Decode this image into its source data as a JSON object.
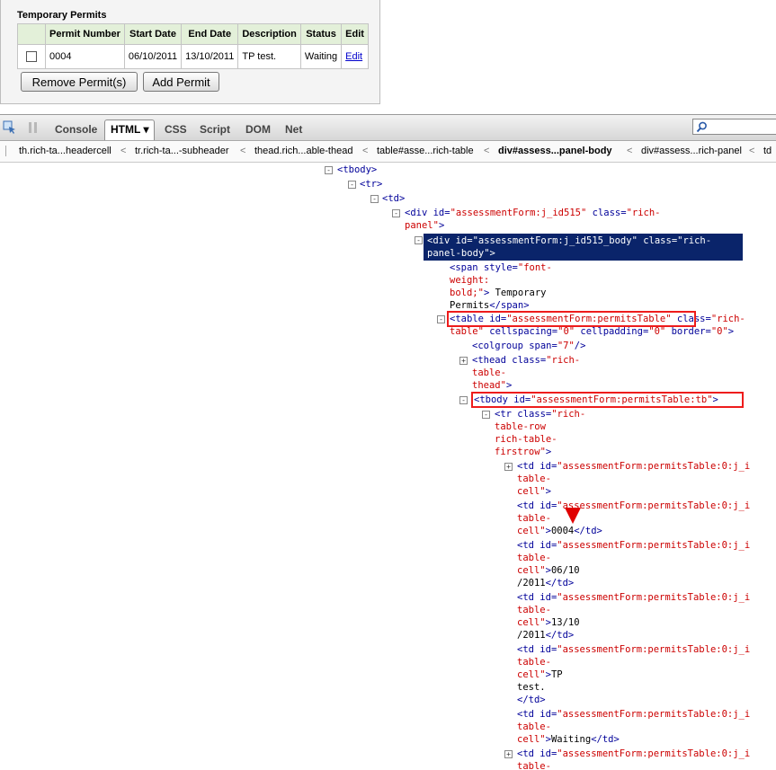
{
  "panel": {
    "title": "Temporary Permits",
    "columns": [
      "",
      "Permit Number",
      "Start Date",
      "End Date",
      "Description",
      "Status",
      "Edit"
    ],
    "row": {
      "permit_number": "0004",
      "start_date": "06/10/2011",
      "end_date": "13/10/2011",
      "description": "TP test.",
      "status": "Waiting",
      "edit": "Edit"
    },
    "buttons": {
      "remove": "Remove Permit(s)",
      "add": "Add Permit"
    }
  },
  "toolbar": {
    "tabs": [
      "Console",
      "HTML",
      "CSS",
      "Script",
      "DOM",
      "Net"
    ],
    "active_tab": "HTML",
    "html_arrow": "▾"
  },
  "breadcrumb": [
    "th.rich-ta...headercell",
    "tr.rich-ta...-subheader",
    "thead.rich...able-thead",
    "table#asse...rich-table",
    "div#assess...panel-body",
    "div#assess...rich-panel",
    "td"
  ],
  "tree": {
    "tbody": "<tbody>",
    "tr": "<tr>",
    "td": "<td>",
    "div1_a": "<div ",
    "div1_b": "id=",
    "div1_c": "\"assessmentForm:j_id515\"",
    "div1_d": " class=",
    "div1_e": "\"rich-",
    "div1_f": "panel\"",
    "div1_g": ">",
    "sel1": "<div id=\"assessmentForm:j_id515_body\" class=\"rich-",
    "sel2": "panel-body\">",
    "span1a": "<span ",
    "span1b": "style=",
    "span1c": "\"font-",
    "span2": "weight:",
    "span3a": "bold;\"",
    "span3b": ">",
    "span3c": " Temporary",
    "span4a": "Permits",
    "span4b": "</span>",
    "table1a": "<table ",
    "table1b": "id=",
    "table1c": "\"assessmentForm:permitsTable\"",
    "table1d": " class=",
    "table1e": "\"rich-",
    "table2a": "table\"",
    "table2b": " cellspacing=",
    "table2c": "\"0\"",
    "table2d": " cellpadding=",
    "table2e": "\"0\"",
    "table2f": " border=",
    "table2g": "\"0\"",
    "table2h": ">",
    "colgroup_a": "<colgroup ",
    "colgroup_b": "span=",
    "colgroup_c": "\"7\"",
    "colgroup_d": "/>",
    "thead1a": "<thead ",
    "thead1b": "class=",
    "thead1c": "\"rich-",
    "thead2": "table-",
    "thead3a": "thead\"",
    "thead3b": ">",
    "tbody2a": "<tbody ",
    "tbody2b": "id=",
    "tbody2c": "\"assessmentForm:permitsTable:tb\"",
    "tbody2d": ">",
    "tr1a": "<tr ",
    "tr1b": "class=",
    "tr1c": "\"rich-",
    "tr2": "table-row",
    "tr3": "rich-table-",
    "tr4a": "firstrow\"",
    "tr4b": ">",
    "td_open": "<td ",
    "td_id": "id=",
    "td_val": "\"assessmentForm:permitsTable:0:j_i",
    "table_dash": "table-",
    "cell_close": "cell\"",
    "gt": ">",
    "v0004": "0004",
    "v_date1a": "06/10",
    "v_date1b": "/2011",
    "v_date2a": "13/10",
    "v_date2b": "/2011",
    "v_tp_a": "TP",
    "v_tp_b": "test.",
    "v_waiting": "Waiting",
    "close_td": "</td>"
  }
}
